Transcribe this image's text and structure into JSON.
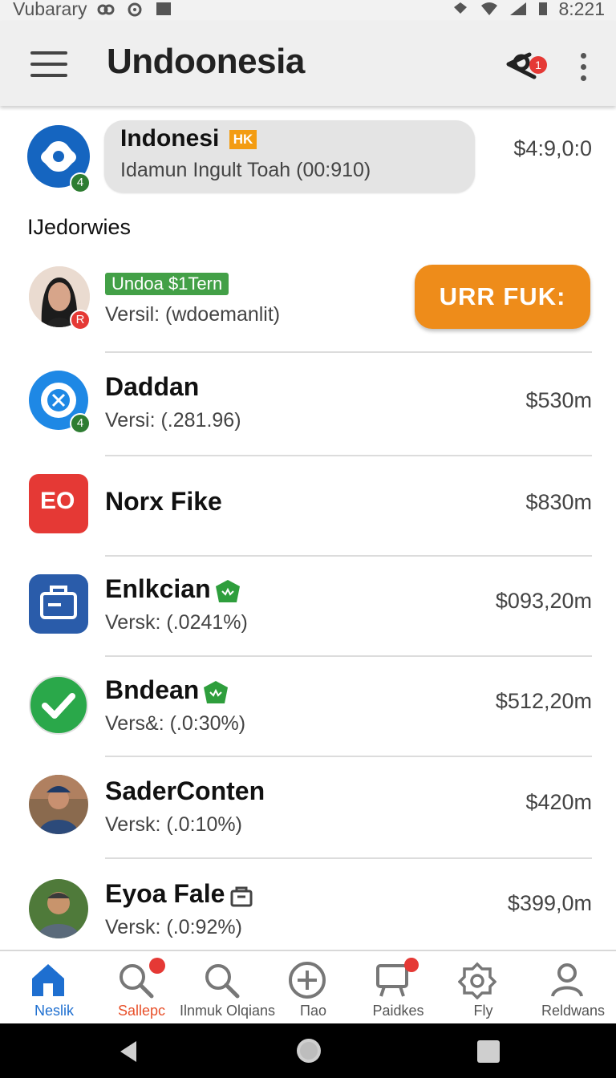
{
  "status_bar": {
    "left_text": "Vubarary",
    "time": "8:221"
  },
  "app_bar": {
    "title": "Undoonesia",
    "notification_count": "1"
  },
  "featured": {
    "badge": "4",
    "title": "Indonesi",
    "tag": "HK",
    "subtitle": "Idamun Ingult Toah (00:910)",
    "price": "$4:9,0:0"
  },
  "section_title": "IJedorwies",
  "highlight": {
    "badge": "R",
    "status_tag": "Undoa $1Tern",
    "subtitle": "Versil: (wdoemanlit)",
    "cta_label": "URR FUK:"
  },
  "items": [
    {
      "name": "Daddan",
      "sub": "Versi: (.281.96)",
      "price": "$530m",
      "badge": "4"
    },
    {
      "name": "Norx Fike",
      "sub": "",
      "price": "$830m",
      "icon_text": "EO"
    },
    {
      "name": "Enlkcian",
      "sub": "Versk: (.0241%)",
      "price": "$093,20m"
    },
    {
      "name": "Bndean",
      "sub": "Vers&: (.0:30%)",
      "price": "$512,20m"
    },
    {
      "name": "SaderConten",
      "sub": "Versk: (.0:10%)",
      "price": "$420m"
    },
    {
      "name": "Eyoa Fale",
      "sub": "Versk: (.0:92%)",
      "price": "$399,0m"
    }
  ],
  "bottom_nav": [
    {
      "label": "Neslik",
      "icon": "home-icon",
      "active": true
    },
    {
      "label": "Sallepc",
      "icon": "search-icon"
    },
    {
      "label": "Ilnmuk Olqians",
      "icon": "search-icon"
    },
    {
      "label": "Пао",
      "icon": "plus-circle-icon"
    },
    {
      "label": "Paidkes",
      "icon": "board-icon"
    },
    {
      "label": "Fly",
      "icon": "gear-icon"
    },
    {
      "label": "Reldwans",
      "icon": "person-icon"
    }
  ],
  "colors": {
    "accent_blue": "#1565c0",
    "cta_orange": "#ee8c1a",
    "badge_green": "#43a047",
    "notification_red": "#e53935",
    "active_nav": "#1e6fd0",
    "selected_label": "#e8502a"
  }
}
